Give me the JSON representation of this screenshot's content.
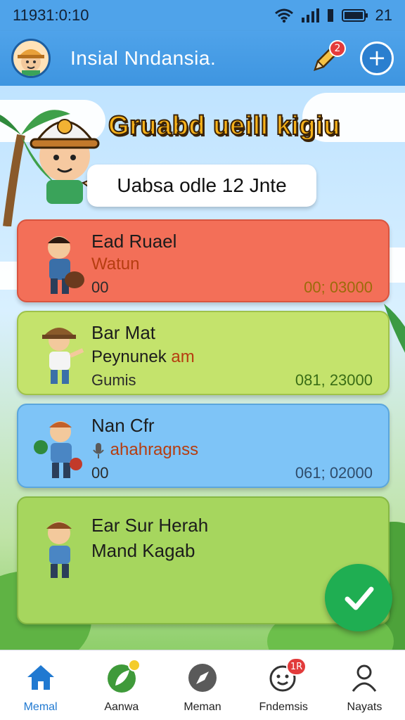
{
  "status_bar": {
    "time": "11931:0:10",
    "battery_text": "21"
  },
  "header": {
    "title": "Insial Nndansia.",
    "pen_badge": "2",
    "add_symbol": "+"
  },
  "hero": {
    "title": "Gruabd ueill kigiu",
    "date_text": "Uabsa odle 12 Jnte"
  },
  "cards": [
    {
      "line1": "Ead Ruael",
      "line2": "Watun",
      "line3": "00",
      "amount": "00; 03000",
      "color_line2": "#b63d10",
      "color_amount": "#9b6b0a"
    },
    {
      "line1": "Bar Mat",
      "line2": "Peynunek",
      "line2_tag": "am",
      "line3": "Gumis",
      "amount": "081, 23000",
      "color_amount": "#3a6d15"
    },
    {
      "line1": "Nan Cfr",
      "line2": "ahahragnss",
      "line3": "00",
      "amount": "061; 02000",
      "color_line2": "#b63d10",
      "color_amount": "#2f4c6b"
    },
    {
      "line1": "Ear Sur Herah",
      "line2": "Mand Kagab"
    }
  ],
  "nav": {
    "items": [
      {
        "label": "Memal",
        "icon": "home-icon",
        "active": true
      },
      {
        "label": "Aanwa",
        "icon": "leaf-icon"
      },
      {
        "label": "Meman",
        "icon": "compass-icon"
      },
      {
        "label": "Fndemsis",
        "icon": "chat-face-icon",
        "badge": "1R"
      },
      {
        "label": "Nayats",
        "icon": "person-icon"
      }
    ]
  },
  "colors": {
    "header_blue": "#4fa3ea",
    "active_blue": "#2079d1",
    "fab_green": "#1fae52",
    "title_gold": "#f7b21a"
  }
}
